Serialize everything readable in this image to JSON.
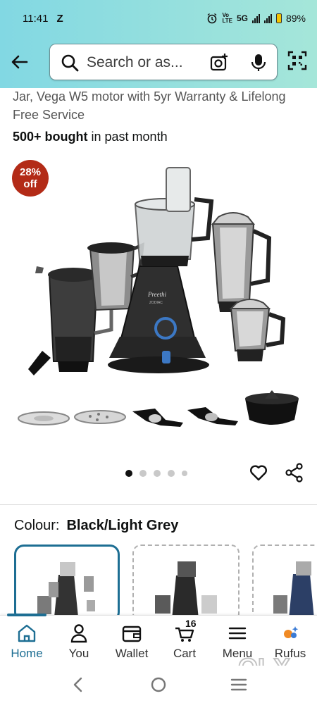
{
  "status_bar": {
    "time": "11:41",
    "carrier_icon": "Z",
    "network": "5G",
    "battery": "89%"
  },
  "search": {
    "placeholder": "Search or as..."
  },
  "product": {
    "title": "Jar, Vega W5 motor with 5yr Warranty & Lifelong Free Service",
    "bought_bold": "500+ bought",
    "bought_rest": " in past month",
    "discount_pct": "28%",
    "discount_word": "off",
    "image_brand": "Preethi",
    "image_model": "ZODIAC"
  },
  "carousel": {
    "total": 5,
    "active_index": 0
  },
  "colour": {
    "label": "Colour:",
    "selected": "Black/Light Grey"
  },
  "bottom_nav": {
    "items": [
      {
        "label": "Home",
        "icon": "home-icon"
      },
      {
        "label": "You",
        "icon": "user-icon"
      },
      {
        "label": "Wallet",
        "icon": "wallet-icon"
      },
      {
        "label": "Cart",
        "icon": "cart-icon",
        "count": "16"
      },
      {
        "label": "Menu",
        "icon": "menu-icon"
      },
      {
        "label": "Rufus",
        "icon": "rufus-icon"
      }
    ]
  },
  "watermark": "OLX",
  "colors": {
    "header_gradient_start": "#82d8e3",
    "header_gradient_end": "#a5e6d9",
    "accent": "#1d6e93",
    "discount": "#b32b17"
  }
}
